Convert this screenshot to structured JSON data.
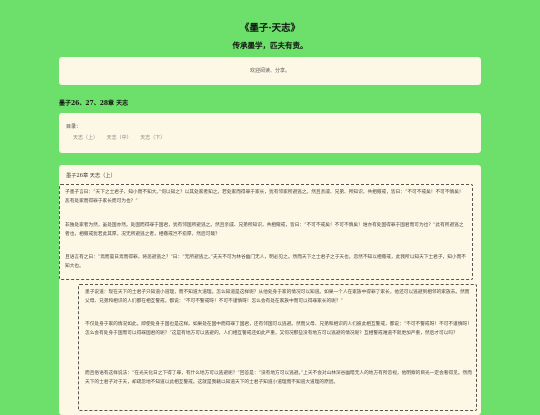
{
  "header": {
    "title": "《墨子·天志》",
    "subtitle": "传承墨学，匹夫有责。"
  },
  "welcome": {
    "text": "欢迎阅读、分享。"
  },
  "section": {
    "title": "墨子26、27、28章 天志"
  },
  "toc": {
    "label": "目录：",
    "links": [
      "天志（上）",
      "天志（中）",
      "天志（下）"
    ]
  },
  "main": {
    "heading": "墨子26章 天志（上）",
    "quote1": [
      "子墨子言曰：“天下之士君子，知小而不知大。”何以知之？以其处家者知之。若处家而得罪于家长，犹有邻家所避逃之。然且亲戚、兄弟、所知识，共相儆戒，皆曰：“不可不戒矣！不可不慎矣！恶有处家而得罪于家长而可为也？”",
      "非独处家者为然，虽处国亦然。处国而得罪于国君，犹有邻国所避逃之。然且亲戚、兄弟所知识，共相儆戒，皆曰：“不可不戒矣！不可不慎矣！谁亦有处国得罪于国君而可为也？”此有所避逃之者也，相儆戒犹若此其厚，况无所避逃之者，相儆戒岂不愈厚，然后可哉？",
      "且语言有之曰：“焉而晏日焉而得罪，将恶避逃之？”曰：“无所避逃之。”夫天不可为林谷幽门无人，明必见之。然而天下之士君子之于天也，忽然不知以相儆戒，此我所以知天下士君子，知小而不知大也。"
    ],
    "quote2": [
      "墨子说道：现在天下的士君子只知道小道理，而不知道大道理。怎么知道是这样呢？从他处身于家的情况可以知道。如果一个人在家族中得罪了家长，他还可以逃避到相邻的家族去。然而父母、兄弟和相识的人们都在相互警戒，都说：“不可不警戒呀！不可不谨慎呀！怎么会有处在家族中而可以得罪家长的呢？”",
      "不仅处身于家的情况如此，即使处身于国也是这样。如果处在国中而得罪了国君，还有邻国可以逃避。然而父母、兄弟和相识的人们彼此相互警戒，都说：“不可不警戒呀！不可不谨慎呀！怎么会有处身于国而可以得罪国君的呢？”这是有地方可以逃避的，人们相互警戒还如此严重，又何况那些没有地方可以逃避的情况呢？互相警戒难道不就更加严重，然后才可以吗？",
      "而且俗语有这样说法：“在光天化日之下得了罪，有什么地方可以逃避呢？”回答是：“没有地方可以逃避。”上天不会对山林深谷幽暗无人的地方有所忽视，他明察的目光一定会看得见。然而天下的士君子对于天，却疏忽地不知道以此相互警戒。这就是我藉以知道天下的士君子知道小道理而不知道大道理的原因。"
    ]
  }
}
